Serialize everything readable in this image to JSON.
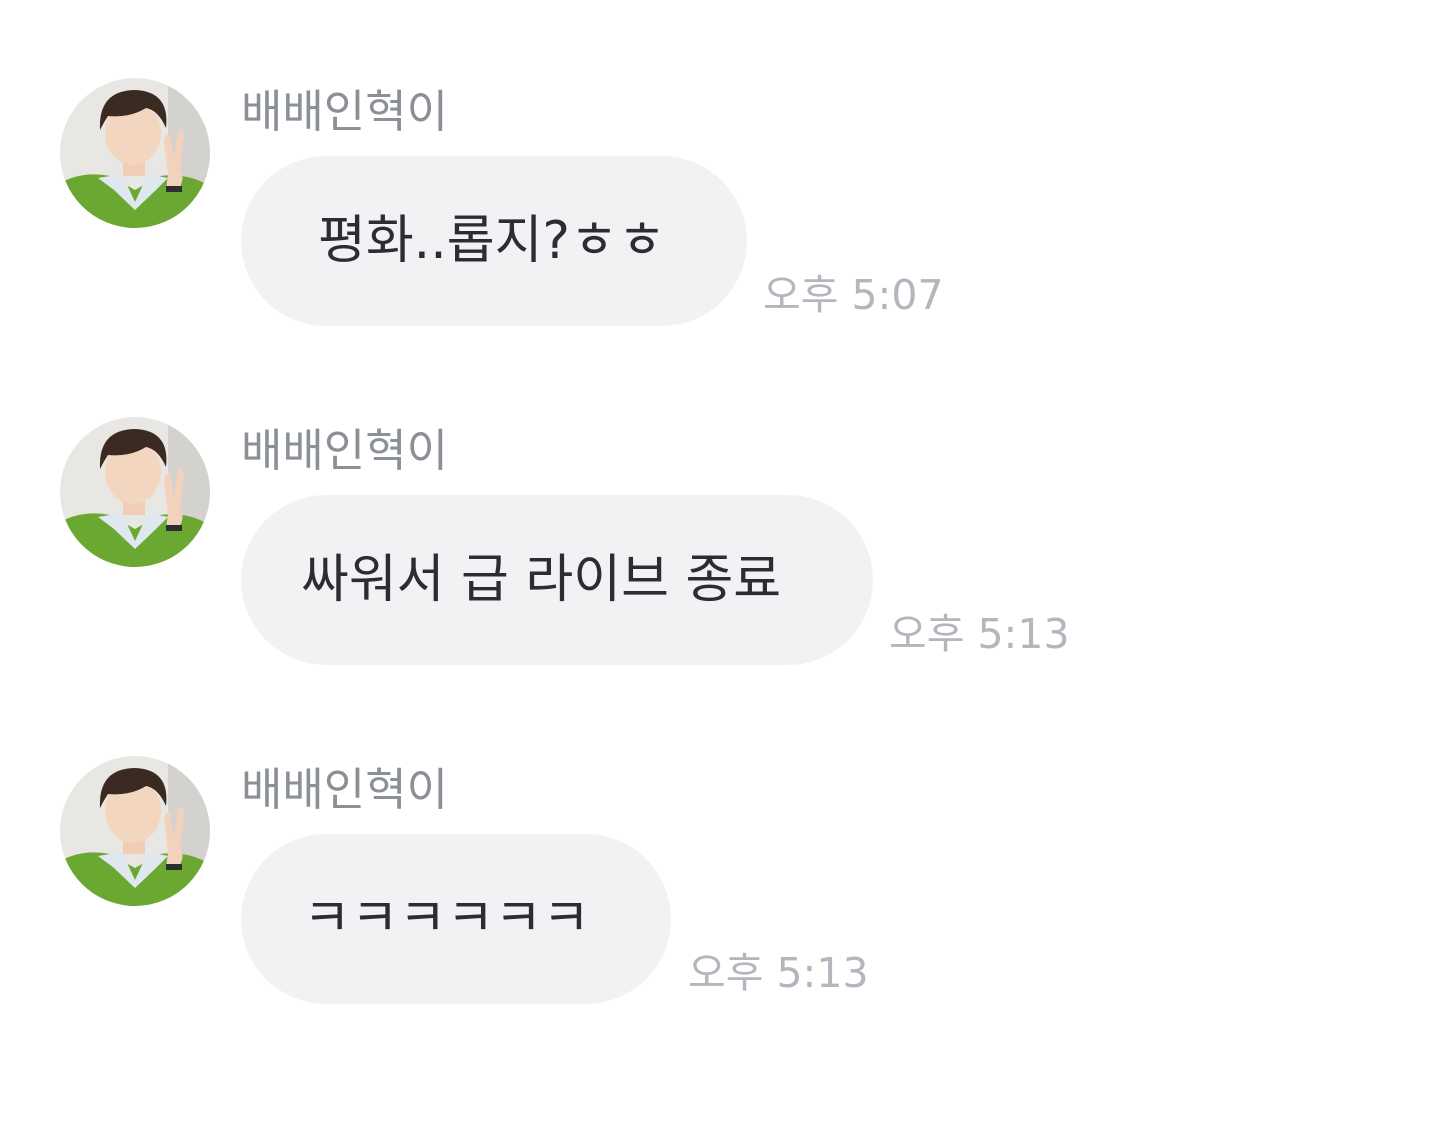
{
  "messages": [
    {
      "sender": "배배인혁이",
      "text": "평화..롭지?ㅎㅎ",
      "time": "오후 5:07"
    },
    {
      "sender": "배배인혁이",
      "text": "싸워서 급 라이브 종료",
      "time": "오후 5:13"
    },
    {
      "sender": "배배인혁이",
      "text": "ㅋㅋㅋㅋㅋㅋ",
      "time": "오후 5:13"
    }
  ],
  "colors": {
    "bubble": "#f2f2f4",
    "message_text": "#2b2d31",
    "sender_text": "#8b8f96",
    "time_text": "#b3b6bc",
    "avatar_sweater": "#6aa832"
  }
}
